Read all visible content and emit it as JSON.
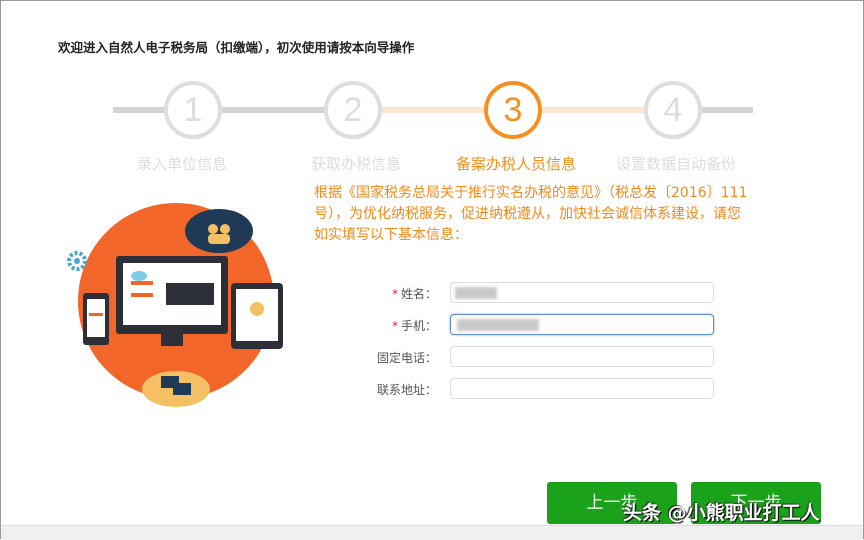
{
  "title": "欢迎进入自然人电子税务局（扣缴端），初次使用请按本向导操作",
  "steps": [
    {
      "num": "1",
      "label": "录入单位信息"
    },
    {
      "num": "2",
      "label": "获取办税信息"
    },
    {
      "num": "3",
      "label": "备案办税人员信息"
    },
    {
      "num": "4",
      "label": "设置数据自动备份"
    }
  ],
  "current_step": 3,
  "notice": "根据《国家税务总局关于推行实名办税的意见》（税总发〔2016〕111号），为优化纳税服务，促进纳税遵从，加快社会诚信体系建设，请您如实填写以下基本信息：",
  "form": {
    "required_mark": "*",
    "name_label": "姓名：",
    "phone_label": "手机：",
    "landline_label": "固定电话：",
    "address_label": "联系地址："
  },
  "buttons": {
    "prev": "上一步",
    "next": "下一步"
  },
  "watermark": "头条 @小熊职业打工人",
  "colors": {
    "accent": "#f39020",
    "button": "#1aa21a"
  }
}
